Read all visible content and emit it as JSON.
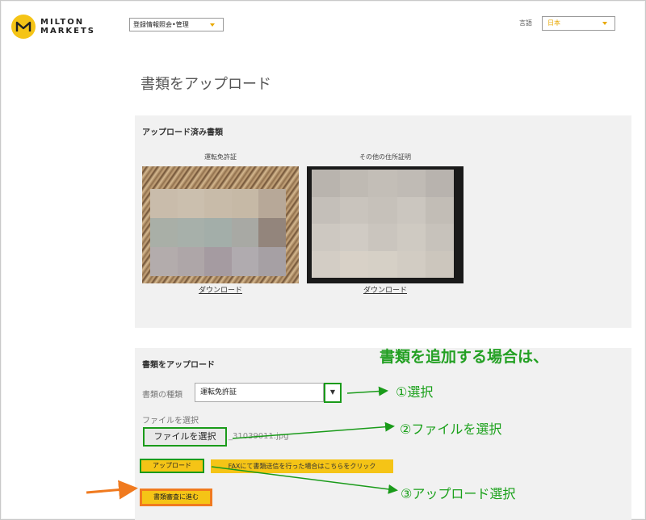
{
  "header": {
    "brand_line1": "MILTON",
    "brand_line2": "MARKETS",
    "menu_select": "登録情報照会•管理",
    "language_label": "言語",
    "language_value": "日本"
  },
  "page": {
    "title": "書類をアップロード"
  },
  "uploaded_section": {
    "heading": "アップロード済み書類",
    "documents": [
      {
        "caption": "運転免許証",
        "download_label": "ダウンロード"
      },
      {
        "caption": "その他の住所証明",
        "download_label": "ダウンロード"
      }
    ]
  },
  "upload_section": {
    "heading": "書類をアップロード",
    "doc_type_label": "書類の種類",
    "doc_type_value": "運転免許証",
    "file_label": "ファイルを選択",
    "file_button": "ファイルを選択",
    "file_name": "_31039011.jpg",
    "upload_button": "アップロード",
    "fax_button": "FAXにて書類送信を行った場合はこちらをクリック",
    "review_button": "書類審査に進む"
  },
  "annotations": {
    "heading": "書類を追加する場合は、",
    "step1": "①選択",
    "step2": "②ファイルを選択",
    "step3": "③アップロード選択"
  },
  "colors": {
    "brand_yellow": "#f5c416",
    "annotation_green": "#1a9b1a",
    "highlight_orange": "#f07a1f"
  }
}
